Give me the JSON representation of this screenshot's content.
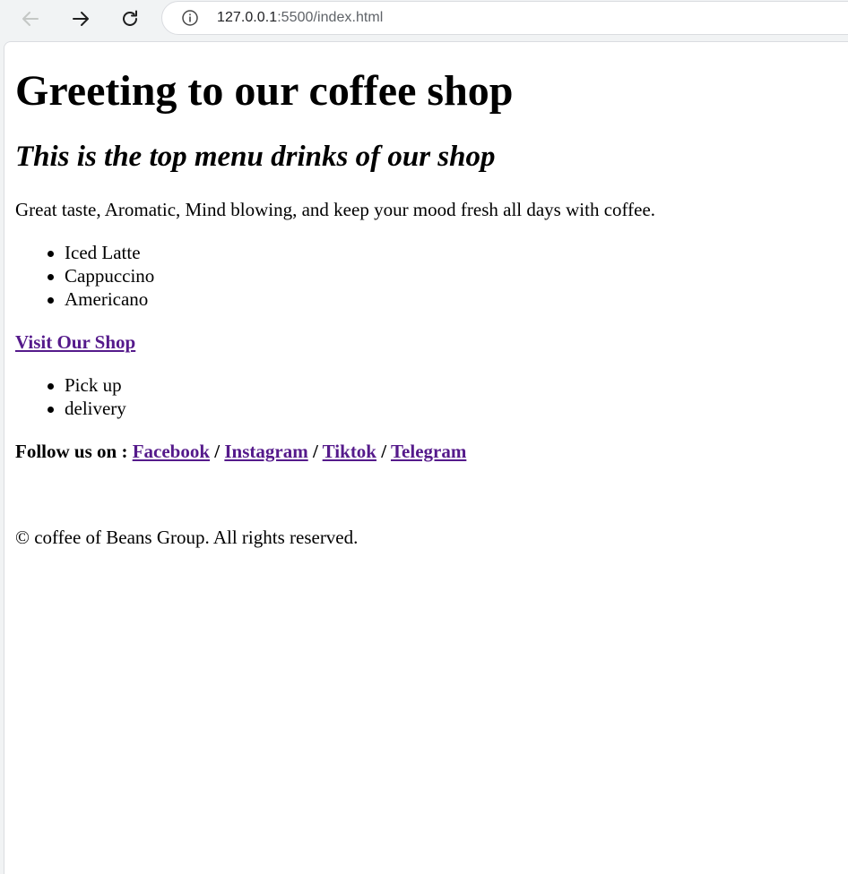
{
  "browser": {
    "url_host": "127.0.0.1",
    "url_rest": ":5500/index.html",
    "icons": {
      "back": "arrow-left-icon",
      "forward": "arrow-right-icon",
      "reload": "reload-icon",
      "info": "info-icon"
    }
  },
  "page": {
    "heading": "Greeting to our coffee shop",
    "subheading": "This is the top menu drinks of our shop",
    "intro": "Great taste, Aromatic, Mind blowing, and keep your mood fresh all days with coffee.",
    "drinks": [
      "Iced Latte",
      "Cappuccino",
      "Americano"
    ],
    "visit_link": "Visit Our Shop",
    "services": [
      "Pick up",
      "delivery"
    ],
    "follow": {
      "label": "Follow us on : ",
      "separator": " / ",
      "links": [
        "Facebook",
        "Instagram",
        "Tiktok",
        "Telegram"
      ]
    },
    "footer": "© coffee of Beans Group. All rights reserved."
  },
  "colors": {
    "visited_link": "#551a8b",
    "toolbar_bg": "#f1f3f4",
    "page_bg": "#ffffff"
  }
}
